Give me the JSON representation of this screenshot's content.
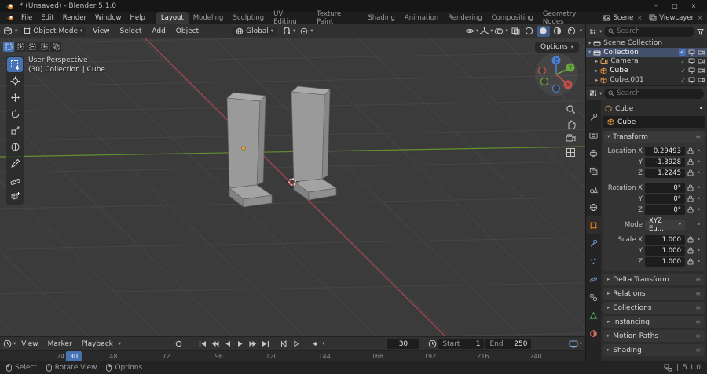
{
  "colors": {
    "accent": "#4772b3",
    "object_orange": "#e87d0d",
    "axis_x": "#a8454f",
    "axis_y": "#609130"
  },
  "icons": {
    "chevron_down": "▾",
    "chevron_right": "▸",
    "check": "✓",
    "grip": "≡",
    "dot": "•",
    "minimize": "–",
    "maximize": "□",
    "close": "×",
    "separator": "|"
  },
  "titlebar": {
    "title": "* (Unsaved) - Blender 5.1.0"
  },
  "menubar": {
    "menus": [
      "File",
      "Edit",
      "Render",
      "Window",
      "Help"
    ],
    "workspaces": [
      "Layout",
      "Modeling",
      "Sculpting",
      "UV Editing",
      "Texture Paint",
      "Shading",
      "Animation",
      "Rendering",
      "Compositing",
      "Geometry Nodes"
    ],
    "scene_label": "Scene",
    "viewlayer_label": "ViewLayer"
  },
  "viewport": {
    "mode": "Object Mode",
    "menus": [
      "View",
      "Select",
      "Add",
      "Object"
    ],
    "orientation": "Global",
    "options_label": "Options",
    "overlay": [
      "User Perspective",
      "(30) Collection | Cube"
    ],
    "gizmo": {
      "x": "X",
      "y": "Y",
      "z": "Z"
    }
  },
  "outliner": {
    "search_placeholder": "Search",
    "scene_collection": "Scene Collection",
    "rows": [
      {
        "label": "Collection"
      },
      {
        "label": "Camera"
      },
      {
        "label": "Cube"
      },
      {
        "label": "Cube.001"
      }
    ]
  },
  "properties": {
    "search_placeholder": "Search",
    "breadcrumb": "Cube",
    "object_name": "Cube",
    "transform": {
      "title": "Transform",
      "rows": [
        {
          "label": "Location X",
          "value": "0.29493"
        },
        {
          "label": "Y",
          "value": "-1.3928"
        },
        {
          "label": "Z",
          "value": "1.2245"
        },
        {
          "label": "Rotation X",
          "value": "0°"
        },
        {
          "label": "Y",
          "value": "0°"
        },
        {
          "label": "Z",
          "value": "0°"
        },
        {
          "label": "Mode",
          "value": "XYZ Eu..."
        },
        {
          "label": "Scale X",
          "value": "1.000"
        },
        {
          "label": "Y",
          "value": "1.000"
        },
        {
          "label": "Z",
          "value": "1.000"
        }
      ]
    },
    "panels": [
      "Delta Transform",
      "Relations",
      "Collections",
      "Instancing",
      "Motion Paths",
      "Shading"
    ]
  },
  "timeline": {
    "menus": [
      "View",
      "Marker",
      "Playback"
    ],
    "frame": "30",
    "start_label": "Start",
    "start_value": "1",
    "end_label": "End",
    "end_value": "250",
    "ticks": [
      24,
      48,
      72,
      96,
      120,
      144,
      168,
      192,
      216,
      240
    ],
    "playhead": {
      "frame": 30,
      "label": "30"
    }
  },
  "statusbar": {
    "items": [
      "Select",
      "Rotate View",
      "Options"
    ],
    "version": "5.1.0"
  }
}
